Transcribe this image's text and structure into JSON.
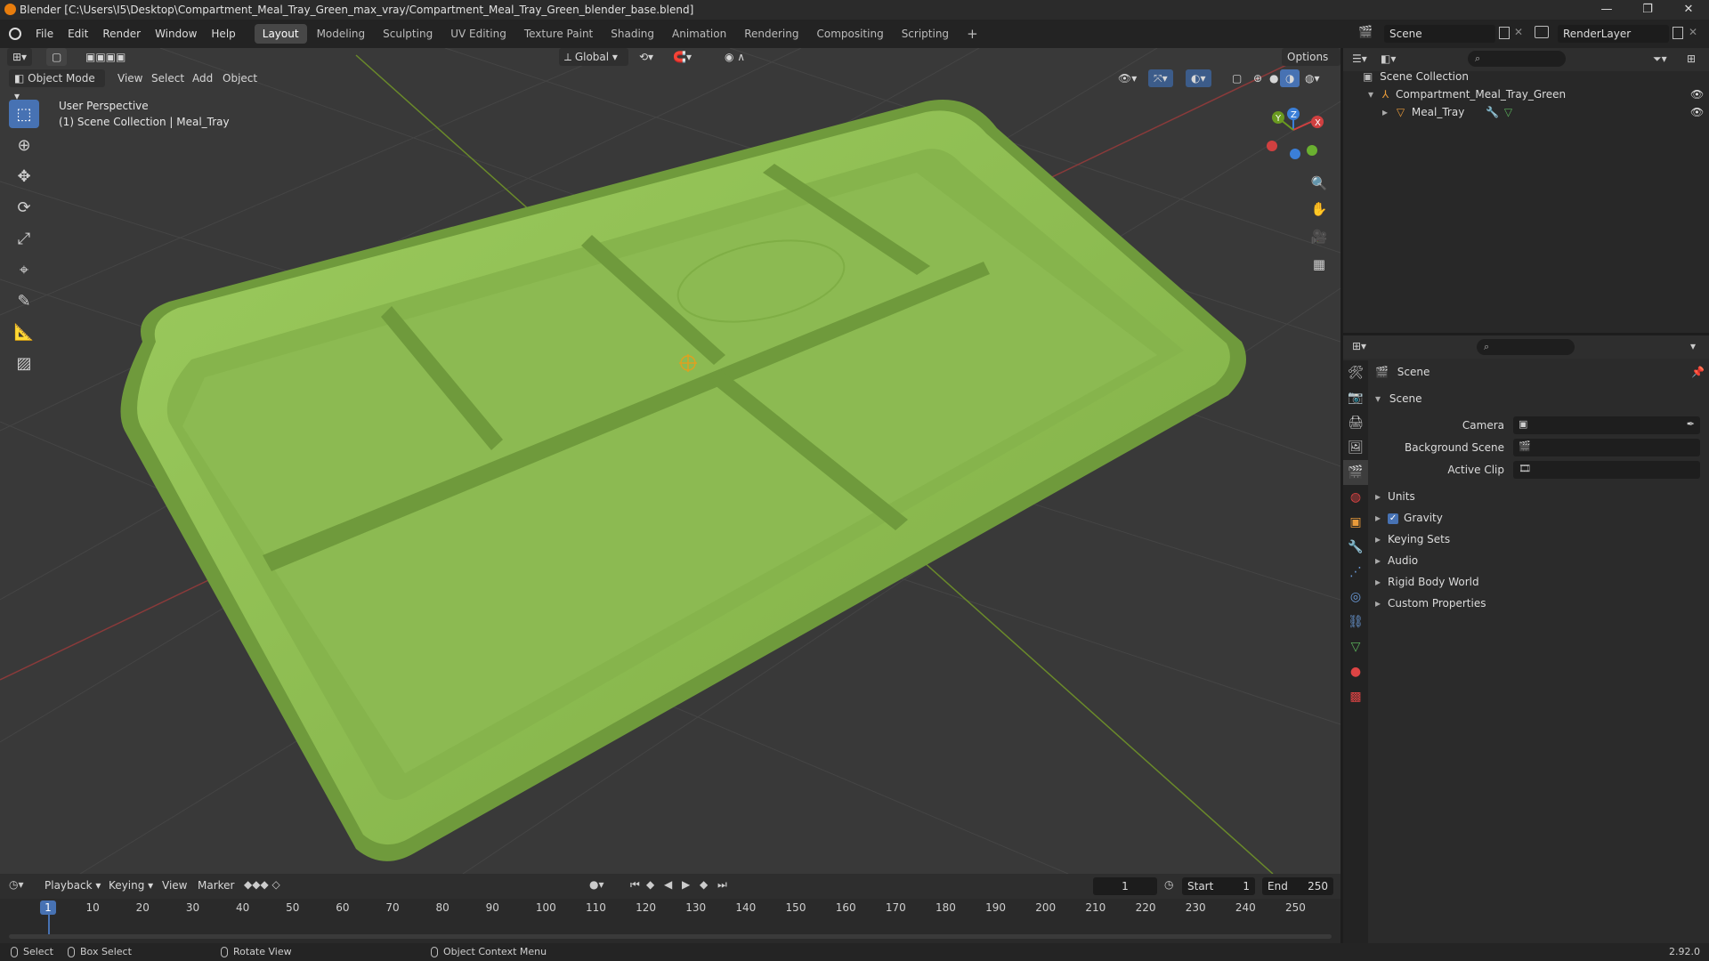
{
  "window": {
    "title": "Blender [C:\\Users\\I5\\Desktop\\Compartment_Meal_Tray_Green_max_vray/Compartment_Meal_Tray_Green_blender_base.blend]",
    "minimize": "—",
    "maximize": "❐",
    "close": "✕"
  },
  "menubar": {
    "items": [
      "File",
      "Edit",
      "Render",
      "Window",
      "Help"
    ],
    "workspaces": [
      "Layout",
      "Modeling",
      "Sculpting",
      "UV Editing",
      "Texture Paint",
      "Shading",
      "Animation",
      "Rendering",
      "Compositing",
      "Scripting"
    ],
    "active_workspace": "Layout",
    "add_workspace": "+",
    "scene_name": "Scene",
    "render_layer": "RenderLayer"
  },
  "viewport": {
    "mode": "Object Mode",
    "menus": [
      "View",
      "Select",
      "Add",
      "Object"
    ],
    "transform_orientation": "Global",
    "options_label": "Options",
    "info_line1": "User Perspective",
    "info_line2": "(1) Scene Collection | Meal_Tray",
    "object_color": "#8fbc52",
    "gizmo": {
      "x": "X",
      "y": "Y",
      "z": "Z"
    }
  },
  "tools": [
    "select-box",
    "cursor",
    "move",
    "rotate",
    "scale",
    "transform",
    "annotate",
    "measure",
    "add-cube"
  ],
  "outliner": {
    "root": "Scene Collection",
    "items": [
      {
        "label": "Compartment_Meal_Tray_Green",
        "type": "collection"
      },
      {
        "label": "Meal_Tray",
        "type": "mesh"
      }
    ]
  },
  "properties": {
    "context_title": "Scene",
    "panel_title": "Scene",
    "fields": [
      {
        "label": "Camera",
        "value": ""
      },
      {
        "label": "Background Scene",
        "value": ""
      },
      {
        "label": "Active Clip",
        "value": ""
      }
    ],
    "subpanels": [
      "Units",
      "Gravity",
      "Keying Sets",
      "Audio",
      "Rigid Body World",
      "Custom Properties"
    ],
    "gravity_checked": true
  },
  "timeline": {
    "menus": [
      "Playback",
      "Keying",
      "View",
      "Marker"
    ],
    "current_frame": "1",
    "start_label": "Start",
    "start": "1",
    "end_label": "End",
    "end": "250",
    "ticks": [
      "1",
      "10",
      "20",
      "30",
      "40",
      "50",
      "60",
      "70",
      "80",
      "90",
      "100",
      "110",
      "120",
      "130",
      "140",
      "150",
      "160",
      "170",
      "180",
      "190",
      "200",
      "210",
      "220",
      "230",
      "240",
      "250"
    ]
  },
  "statusbar": {
    "select": "Select",
    "box_select": "Box Select",
    "rotate_view": "Rotate View",
    "context_menu": "Object Context Menu",
    "version": "2.92.0"
  }
}
